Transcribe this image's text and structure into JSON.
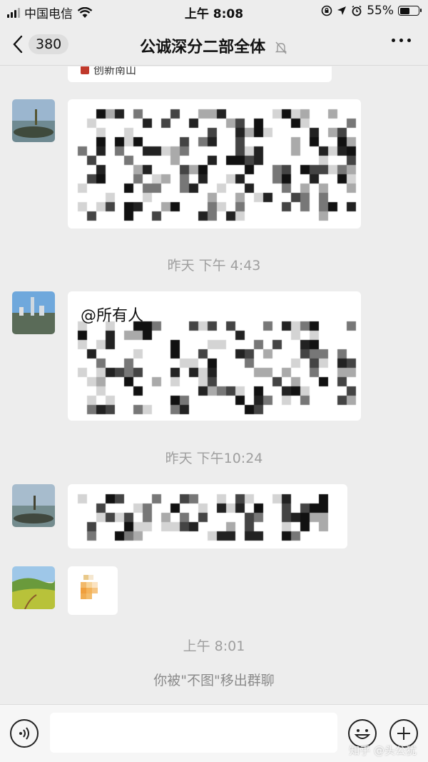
{
  "status_bar": {
    "carrier": "中国电信",
    "time": "上午 8:08",
    "battery": "55%",
    "battery_level": 0.55
  },
  "nav": {
    "unread_count": "380",
    "title": "公诚深分二部全体"
  },
  "messages": {
    "prev_card_source": "创新南山",
    "msg1_text_fragment": "",
    "timestamp_1": "昨天 下午 4:43",
    "msg2_text": "@所有人",
    "timestamp_2": "昨天 下午10:24",
    "timestamp_3": "上午 8:01",
    "system_notice": "你被\"不图\"移出群聊"
  },
  "input_bar": {
    "input_value": ""
  },
  "watermark": "知乎 @头公犹",
  "colors": {
    "background": "#ededed",
    "bubble": "#ffffff",
    "timestamp": "#9e9e9e"
  }
}
